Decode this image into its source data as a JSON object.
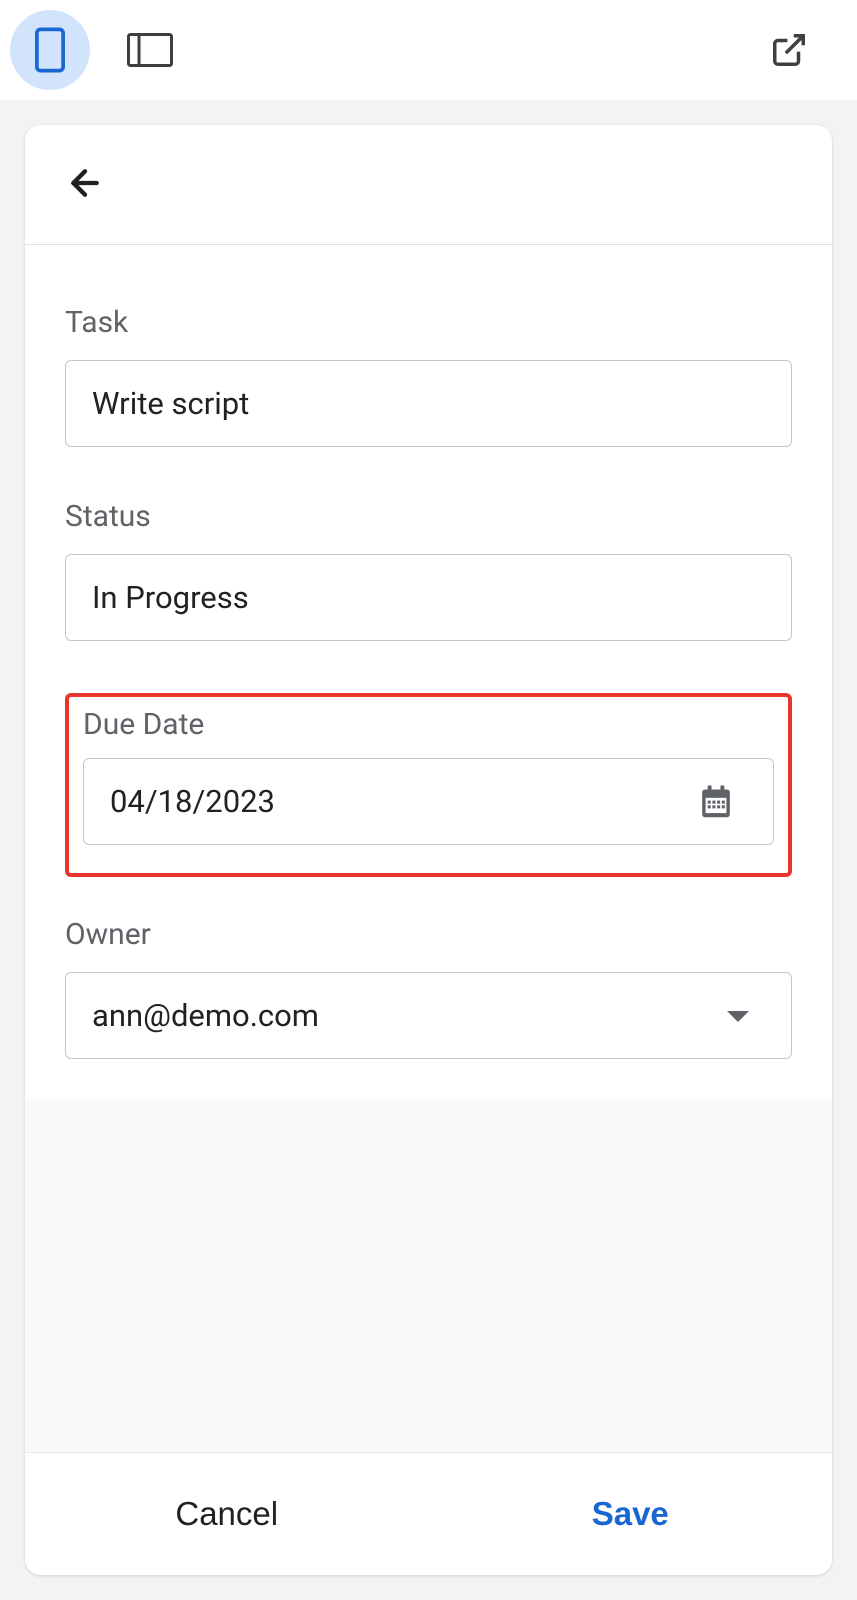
{
  "toolbar": {
    "mobile_icon": "mobile",
    "tablet_icon": "tablet",
    "external_icon": "external"
  },
  "form": {
    "task": {
      "label": "Task",
      "value": "Write script"
    },
    "status": {
      "label": "Status",
      "value": "In Progress"
    },
    "due_date": {
      "label": "Due Date",
      "value": "04/18/2023"
    },
    "owner": {
      "label": "Owner",
      "value": "ann@demo.com"
    }
  },
  "actions": {
    "cancel": "Cancel",
    "save": "Save"
  }
}
